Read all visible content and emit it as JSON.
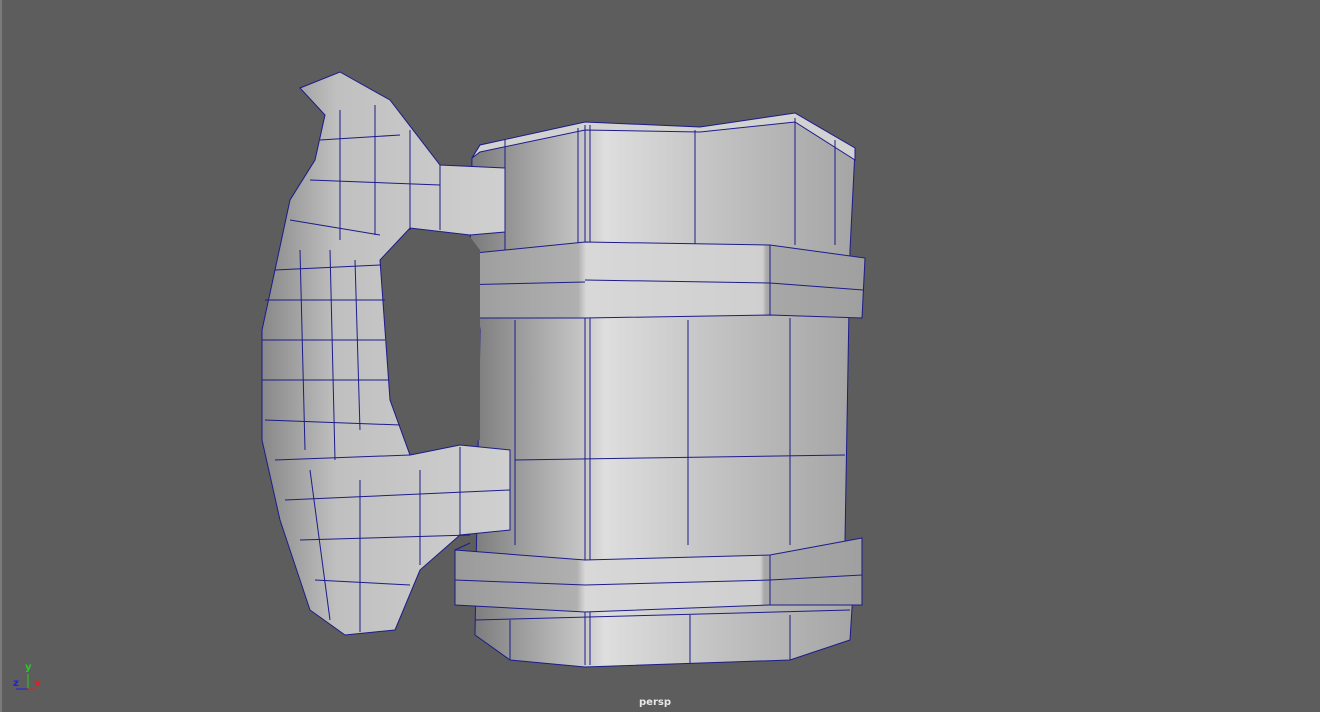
{
  "viewport": {
    "camera_label": "persp",
    "background": "#5d5d5d",
    "wire_color": "#1c1c8a",
    "model": "mug-mesh",
    "axis_gizmo": {
      "x_label": "x",
      "y_label": "y",
      "z_label": "z",
      "x_color": "#e02020",
      "y_color": "#20d020",
      "z_color": "#2020e0"
    }
  }
}
